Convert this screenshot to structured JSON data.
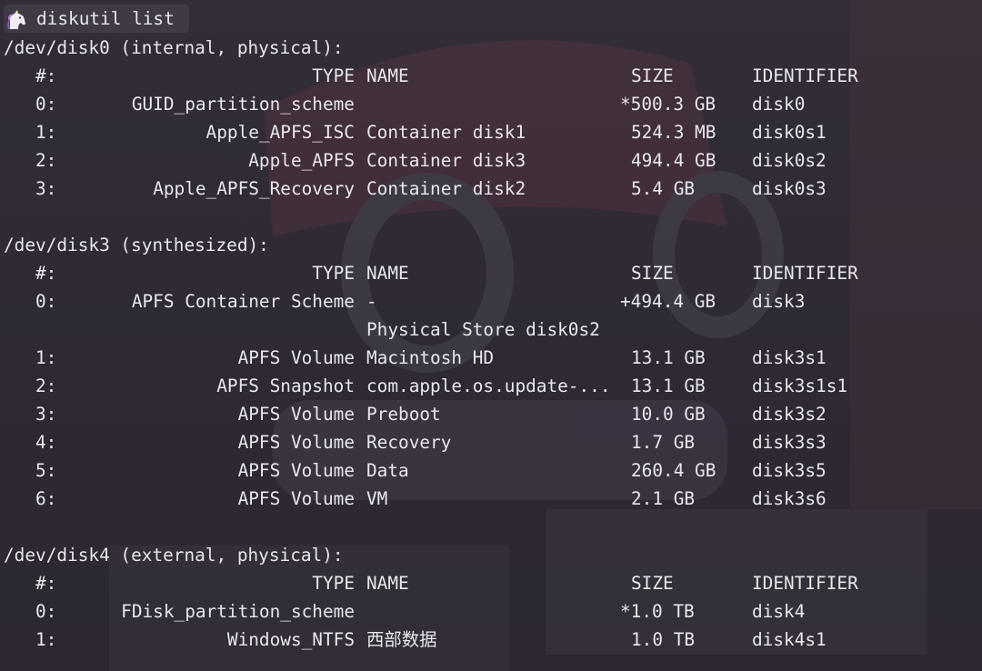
{
  "prompt": {
    "icon": "unicorn-icon",
    "command": "diskutil list"
  },
  "columns": {
    "index": "#:",
    "type": "TYPE",
    "name": "NAME",
    "size": "SIZE",
    "identifier": "IDENTIFIER"
  },
  "disks": [
    {
      "header": "/dev/disk0 (internal, physical):",
      "rows": [
        {
          "index": "0:",
          "type": "GUID_partition_scheme",
          "name": "",
          "size": "*500.3 GB",
          "identifier": "disk0"
        },
        {
          "index": "1:",
          "type": "Apple_APFS_ISC",
          "name": "Container disk1",
          "size": "524.3 MB",
          "identifier": "disk0s1"
        },
        {
          "index": "2:",
          "type": "Apple_APFS",
          "name": "Container disk3",
          "size": "494.4 GB",
          "identifier": "disk0s2"
        },
        {
          "index": "3:",
          "type": "Apple_APFS_Recovery",
          "name": "Container disk2",
          "size": "5.4 GB",
          "identifier": "disk0s3"
        }
      ]
    },
    {
      "header": "/dev/disk3 (synthesized):",
      "rows": [
        {
          "index": "0:",
          "type": "APFS Container Scheme",
          "name": "-",
          "size": "+494.4 GB",
          "identifier": "disk3"
        },
        {
          "index": "",
          "type": "",
          "name": "Physical Store disk0s2",
          "size": "",
          "identifier": ""
        },
        {
          "index": "1:",
          "type": "APFS Volume",
          "name": "Macintosh HD",
          "size": "13.1 GB",
          "identifier": "disk3s1"
        },
        {
          "index": "2:",
          "type": "APFS Snapshot",
          "name": "com.apple.os.update-...",
          "size": "13.1 GB",
          "identifier": "disk3s1s1"
        },
        {
          "index": "3:",
          "type": "APFS Volume",
          "name": "Preboot",
          "size": "10.0 GB",
          "identifier": "disk3s2"
        },
        {
          "index": "4:",
          "type": "APFS Volume",
          "name": "Recovery",
          "size": "1.7 GB",
          "identifier": "disk3s3"
        },
        {
          "index": "5:",
          "type": "APFS Volume",
          "name": "Data",
          "size": "260.4 GB",
          "identifier": "disk3s5"
        },
        {
          "index": "6:",
          "type": "APFS Volume",
          "name": "VM",
          "size": "2.1 GB",
          "identifier": "disk3s6"
        }
      ]
    },
    {
      "header": "/dev/disk4 (external, physical):",
      "rows": [
        {
          "index": "0:",
          "type": "FDisk_partition_scheme",
          "name": "",
          "size": "*1.0 TB",
          "identifier": "disk4"
        },
        {
          "index": "1:",
          "type": "Windows_NTFS",
          "name": "西部数据",
          "size": "1.0 TB",
          "identifier": "disk4s1"
        }
      ]
    }
  ],
  "colors": {
    "background": "#2f2a35",
    "text": "#e9e6ee",
    "prompt_highlight": "#3f3a46"
  }
}
